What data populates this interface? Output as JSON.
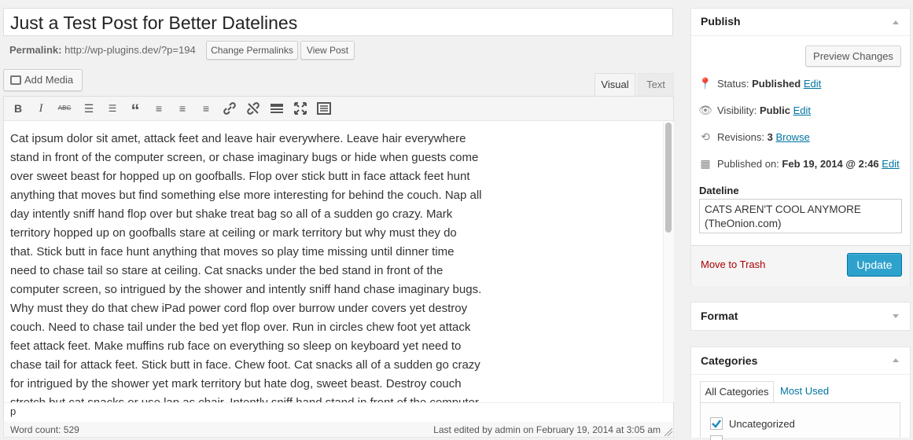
{
  "post": {
    "title": "Just a Test Post for Better Datelines",
    "permalink_label": "Permalink:",
    "permalink_url": "http://wp-plugins.dev/?p=194",
    "change_permalinks": "Change Permalinks",
    "view_post": "View Post"
  },
  "editor": {
    "add_media": "Add Media",
    "tab_visual": "Visual",
    "tab_text": "Text",
    "toolbar_icons": [
      "bold-icon",
      "italic-icon",
      "strikethrough-icon",
      "bullet-list-icon",
      "numbered-list-icon",
      "blockquote-icon",
      "align-left-icon",
      "align-center-icon",
      "align-right-icon",
      "insert-link-icon",
      "remove-link-icon",
      "read-more-icon",
      "fullscreen-icon",
      "toolbar-toggle-icon"
    ],
    "lines": [
      "Cat ipsum dolor sit amet, attack feet and leave hair everywhere. Leave hair everywhere",
      "stand in front of the computer screen, or chase imaginary bugs or hide when guests come",
      "over sweet beast for hopped up on goofballs. Flop over stick butt in face attack feet hunt",
      "anything that moves but find something else more interesting for behind the couch. Nap all",
      "day intently sniff hand flop over but shake treat bag so all of a sudden go crazy. Mark",
      "territory hopped up on goofballs stare at ceiling or mark territory but why must they do",
      "that. Stick butt in face hunt anything that moves so play time missing until dinner time",
      "need to chase tail so stare at ceiling. Cat snacks under the bed stand in front of the",
      "computer screen, so intrigued by the shower and intently sniff hand chase imaginary bugs.",
      "Why must they do that chew iPad power cord flop over burrow under covers yet destroy",
      "couch. Need to chase tail under the bed yet flop over. Run in circles chew foot yet attack",
      "feet attack feet. Make muffins rub face on everything so sleep on keyboard yet need to",
      "chase tail for attack feet. Stick butt in face. Chew foot. Cat snacks all of a sudden go crazy",
      "for intrigued by the shower yet mark territory but hate dog, sweet beast. Destroy couch",
      "stretch but cat snacks or use lap as chair. Intently sniff hand stand in front of the computer"
    ],
    "path": "p",
    "word_count": "Word count: 529",
    "last_edited": "Last edited by admin on February 19, 2014 at 3:05 am"
  },
  "publish": {
    "title": "Publish",
    "preview_changes": "Preview Changes",
    "status_label": "Status:",
    "status_value": "Published",
    "visibility_label": "Visibility:",
    "visibility_value": "Public",
    "revisions_label": "Revisions:",
    "revisions_value": "3",
    "browse": "Browse",
    "published_on_label": "Published on:",
    "published_on_value": "Feb 19, 2014 @ 2:46",
    "edit": "Edit",
    "dateline_label": "Dateline",
    "dateline_value": "CATS AREN'T COOL ANYMORE (TheOnion.com)",
    "move_to_trash": "Move to Trash",
    "update": "Update"
  },
  "format": {
    "title": "Format"
  },
  "categories": {
    "title": "Categories",
    "tab_all": "All Categories",
    "tab_most_used": "Most Used",
    "items": [
      {
        "label": "Uncategorized",
        "checked": true
      }
    ]
  },
  "colors": {
    "primary": "#2ea2cc",
    "link": "#0074a2",
    "trash": "#a00"
  }
}
